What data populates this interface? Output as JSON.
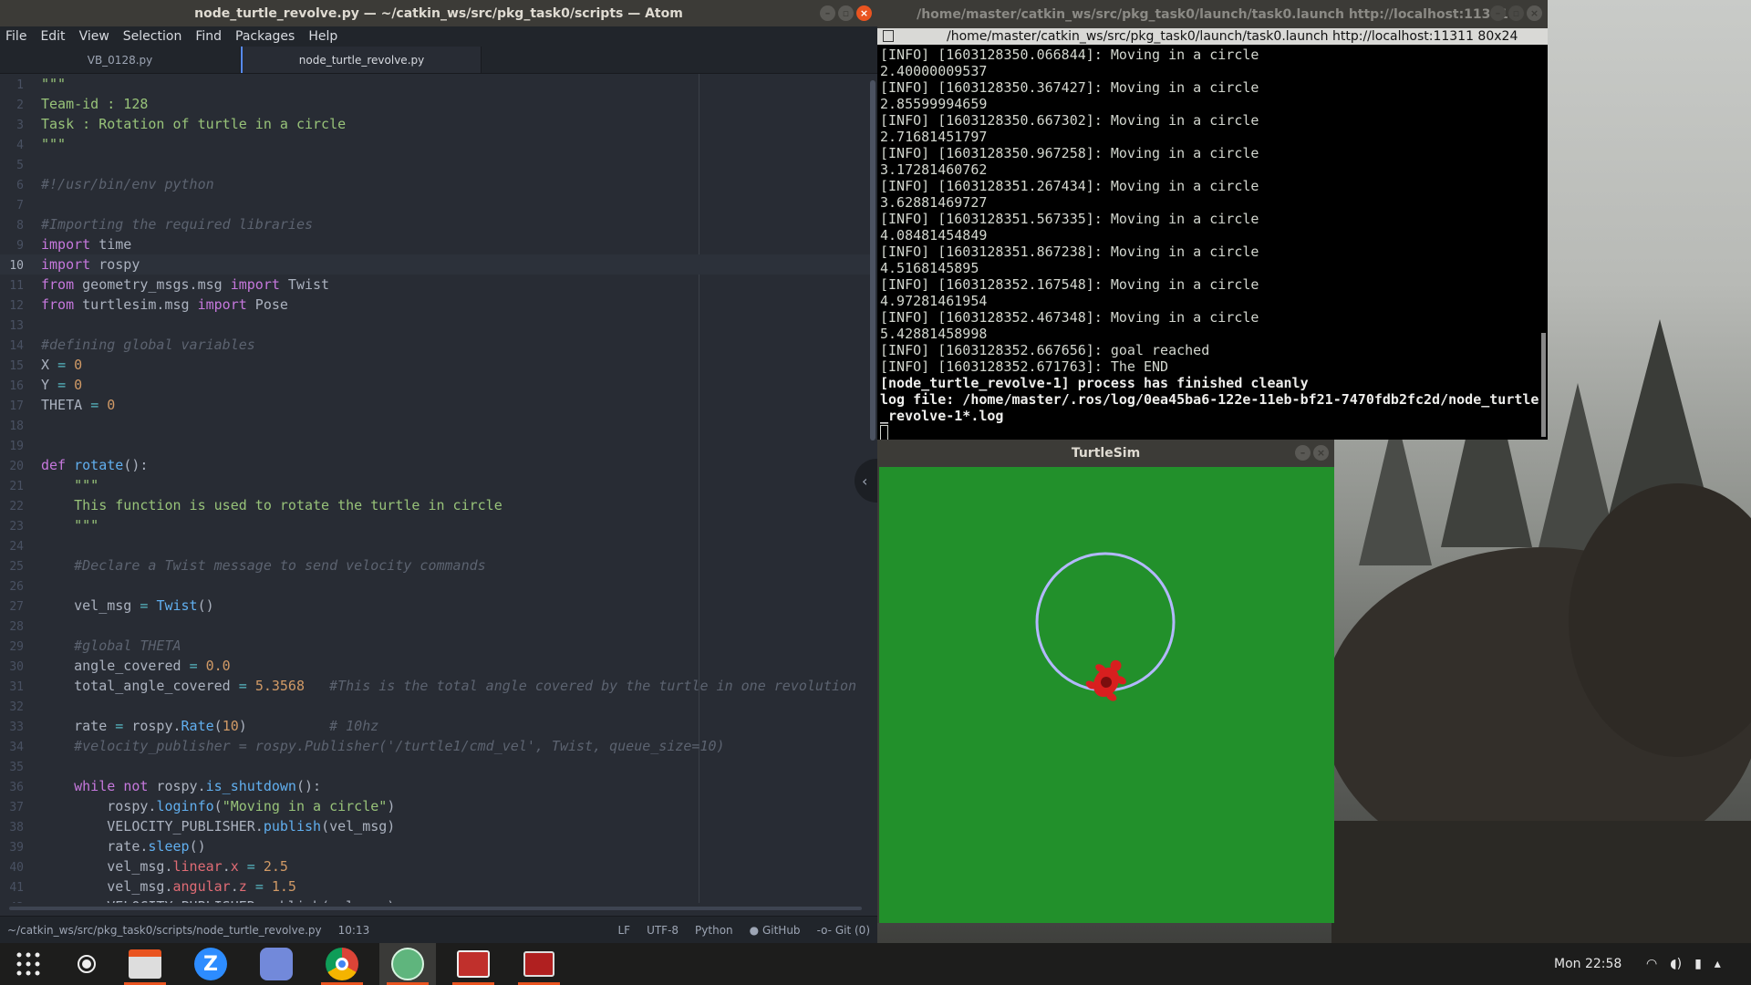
{
  "atom": {
    "title": "node_turtle_revolve.py — ~/catkin_ws/src/pkg_task0/scripts — Atom",
    "menu": [
      "File",
      "Edit",
      "View",
      "Selection",
      "Find",
      "Packages",
      "Help"
    ],
    "tabs": [
      "VB_0128.py",
      "node_turtle_revolve.py"
    ],
    "active_tab": 1,
    "cursor_line": 10,
    "lines": [
      [
        [
          "\"\"\"",
          "c-str"
        ]
      ],
      [
        [
          "Team-id : 128",
          "c-str"
        ]
      ],
      [
        [
          "Task : Rotation of turtle in a circle",
          "c-str"
        ]
      ],
      [
        [
          "\"\"\"",
          "c-str"
        ]
      ],
      [],
      [
        [
          "#!/usr/bin/env python",
          "c-cmt"
        ]
      ],
      [],
      [
        [
          "#Importing the required libraries",
          "c-cmt"
        ]
      ],
      [
        [
          "import",
          "c-kw"
        ],
        [
          " time",
          ""
        ]
      ],
      [
        [
          "import",
          "c-kw"
        ],
        [
          " rospy",
          ""
        ]
      ],
      [
        [
          "from",
          "c-kw"
        ],
        [
          " geometry_msgs.msg ",
          ""
        ],
        [
          "import",
          "c-kw"
        ],
        [
          " Twist",
          ""
        ]
      ],
      [
        [
          "from",
          "c-kw"
        ],
        [
          " turtlesim.msg ",
          ""
        ],
        [
          "import",
          "c-kw"
        ],
        [
          " Pose",
          ""
        ]
      ],
      [],
      [
        [
          "#defining global variables",
          "c-cmt"
        ]
      ],
      [
        [
          "X ",
          ""
        ],
        [
          "=",
          "c-op"
        ],
        [
          " ",
          ""
        ],
        [
          "0",
          "c-num"
        ]
      ],
      [
        [
          "Y ",
          ""
        ],
        [
          "=",
          "c-op"
        ],
        [
          " ",
          ""
        ],
        [
          "0",
          "c-num"
        ]
      ],
      [
        [
          "THETA ",
          ""
        ],
        [
          "=",
          "c-op"
        ],
        [
          " ",
          ""
        ],
        [
          "0",
          "c-num"
        ]
      ],
      [],
      [],
      [
        [
          "def",
          "c-kw"
        ],
        [
          " ",
          ""
        ],
        [
          "rotate",
          "c-fn"
        ],
        [
          "():",
          ""
        ]
      ],
      [
        [
          "    ",
          ""
        ],
        [
          "\"\"\"",
          "c-str"
        ]
      ],
      [
        [
          "    ",
          ""
        ],
        [
          "This function is used to rotate the turtle in circle",
          "c-str"
        ]
      ],
      [
        [
          "    ",
          ""
        ],
        [
          "\"\"\"",
          "c-str"
        ]
      ],
      [],
      [
        [
          "    ",
          ""
        ],
        [
          "#Declare a Twist message to send velocity commands",
          "c-cmt"
        ]
      ],
      [],
      [
        [
          "    vel_msg ",
          ""
        ],
        [
          "=",
          "c-op"
        ],
        [
          " ",
          ""
        ],
        [
          "Twist",
          "c-fn"
        ],
        [
          "()",
          ""
        ]
      ],
      [],
      [
        [
          "    ",
          ""
        ],
        [
          "#global THETA",
          "c-cmt"
        ]
      ],
      [
        [
          "    angle_covered ",
          ""
        ],
        [
          "=",
          "c-op"
        ],
        [
          " ",
          ""
        ],
        [
          "0.0",
          "c-num"
        ]
      ],
      [
        [
          "    total_angle_covered ",
          ""
        ],
        [
          "=",
          "c-op"
        ],
        [
          " ",
          ""
        ],
        [
          "5.3568",
          "c-num"
        ],
        [
          "   ",
          ""
        ],
        [
          "#This is the total angle covered by the turtle in one revolution",
          "c-cmt"
        ]
      ],
      [],
      [
        [
          "    rate ",
          ""
        ],
        [
          "=",
          "c-op"
        ],
        [
          " rospy.",
          ""
        ],
        [
          "Rate",
          "c-fn"
        ],
        [
          "(",
          ""
        ],
        [
          "10",
          "c-num"
        ],
        [
          ")",
          ""
        ],
        [
          "          ",
          ""
        ],
        [
          "# 10hz",
          "c-cmt"
        ]
      ],
      [
        [
          "    ",
          ""
        ],
        [
          "#velocity_publisher = rospy.Publisher('/turtle1/cmd_vel', Twist, queue_size=10)",
          "c-cmt"
        ]
      ],
      [],
      [
        [
          "    ",
          ""
        ],
        [
          "while",
          "c-kw"
        ],
        [
          " ",
          ""
        ],
        [
          "not",
          "c-kw"
        ],
        [
          " rospy.",
          ""
        ],
        [
          "is_shutdown",
          "c-fn"
        ],
        [
          "():",
          ""
        ]
      ],
      [
        [
          "        rospy.",
          ""
        ],
        [
          "loginfo",
          "c-fn"
        ],
        [
          "(",
          ""
        ],
        [
          "\"Moving in a circle\"",
          "c-str"
        ],
        [
          ")",
          ""
        ]
      ],
      [
        [
          "        VELOCITY_PUBLISHER.",
          ""
        ],
        [
          "publish",
          "c-fn"
        ],
        [
          "(vel_msg)",
          ""
        ]
      ],
      [
        [
          "        rate.",
          ""
        ],
        [
          "sleep",
          "c-fn"
        ],
        [
          "()",
          ""
        ]
      ],
      [
        [
          "        vel_msg.",
          ""
        ],
        [
          "linear",
          "c-prop"
        ],
        [
          ".",
          ""
        ],
        [
          "x",
          "c-prop"
        ],
        [
          " ",
          ""
        ],
        [
          "=",
          "c-op"
        ],
        [
          " ",
          ""
        ],
        [
          "2.5",
          "c-num"
        ]
      ],
      [
        [
          "        vel_msg.",
          ""
        ],
        [
          "angular",
          "c-prop"
        ],
        [
          ".",
          ""
        ],
        [
          "z",
          "c-prop"
        ],
        [
          " ",
          ""
        ],
        [
          "=",
          "c-op"
        ],
        [
          " ",
          ""
        ],
        [
          "1.5",
          "c-num"
        ]
      ],
      [
        [
          "        VELOCITY_PUBLISHER.publish(vel_msg)",
          ""
        ]
      ]
    ],
    "status": {
      "path": "~/catkin_ws/src/pkg_task0/scripts/node_turtle_revolve.py",
      "cursor": "10:13",
      "line_ending": "LF",
      "encoding": "UTF-8",
      "grammar": "Python",
      "github": "GitHub",
      "git": "Git (0)"
    }
  },
  "terminal": {
    "title": "/home/master/catkin_ws/src/pkg_task0/launch/task0.launch http://localhost:11311",
    "tab_title": "/home/master/catkin_ws/src/pkg_task0/launch/task0.launch http://localhost:11311 80x24",
    "lines": [
      {
        "text": "[INFO] [1603128350.066844]: Moving in a circle",
        "bold": false
      },
      {
        "text": "2.40000009537",
        "bold": false
      },
      {
        "text": "[INFO] [1603128350.367427]: Moving in a circle",
        "bold": false
      },
      {
        "text": "2.85599994659",
        "bold": false
      },
      {
        "text": "[INFO] [1603128350.667302]: Moving in a circle",
        "bold": false
      },
      {
        "text": "2.71681451797",
        "bold": false
      },
      {
        "text": "[INFO] [1603128350.967258]: Moving in a circle",
        "bold": false
      },
      {
        "text": "3.17281460762",
        "bold": false
      },
      {
        "text": "[INFO] [1603128351.267434]: Moving in a circle",
        "bold": false
      },
      {
        "text": "3.62881469727",
        "bold": false
      },
      {
        "text": "[INFO] [1603128351.567335]: Moving in a circle",
        "bold": false
      },
      {
        "text": "4.08481454849",
        "bold": false
      },
      {
        "text": "[INFO] [1603128351.867238]: Moving in a circle",
        "bold": false
      },
      {
        "text": "4.5168145895",
        "bold": false
      },
      {
        "text": "[INFO] [1603128352.167548]: Moving in a circle",
        "bold": false
      },
      {
        "text": "4.97281461954",
        "bold": false
      },
      {
        "text": "[INFO] [1603128352.467348]: Moving in a circle",
        "bold": false
      },
      {
        "text": "5.42881458998",
        "bold": false
      },
      {
        "text": "[INFO] [1603128352.667656]: goal reached",
        "bold": false
      },
      {
        "text": "[INFO] [1603128352.671763]: The END",
        "bold": false
      },
      {
        "text": "[node_turtle_revolve-1] process has finished cleanly",
        "bold": true
      },
      {
        "text": "log file: /home/master/.ros/log/0ea45ba6-122e-11eb-bf21-7470fdb2fc2d/node_turtle",
        "bold": true
      },
      {
        "text": "_revolve-1*.log",
        "bold": true
      }
    ]
  },
  "turtlesim": {
    "title": "TurtleSim",
    "background_color": "#22902b",
    "path_color": "#b3b8ff",
    "turtle_color": "#d81f1f"
  },
  "taskbar": {
    "apps": [
      {
        "name": "show-applications",
        "icon": "apps-grid-icon",
        "running": false
      },
      {
        "name": "screen-recorder",
        "icon": "record-icon",
        "running": false
      },
      {
        "name": "files",
        "icon": "files-icon",
        "running": true
      },
      {
        "name": "zoom",
        "icon": "zoom-icon",
        "running": false
      },
      {
        "name": "discord",
        "icon": "discord-icon",
        "running": false
      },
      {
        "name": "chrome",
        "icon": "chrome-icon",
        "running": true
      },
      {
        "name": "atom",
        "icon": "atom-icon",
        "running": true
      },
      {
        "name": "terminal",
        "icon": "terminal-icon",
        "running": true
      },
      {
        "name": "turtlesim",
        "icon": "turtlesim-icon",
        "running": true
      }
    ],
    "clock": "Mon 22:58"
  }
}
